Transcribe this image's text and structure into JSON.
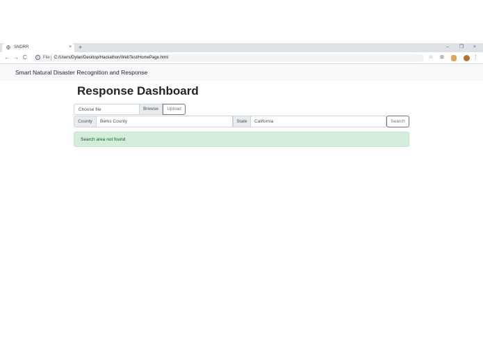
{
  "browser": {
    "tab_title": "SNDRR",
    "tab_close": "×",
    "new_tab": "+",
    "window_controls": {
      "minimize": "–",
      "restore": "❐",
      "close": "×"
    },
    "nav": {
      "back": "←",
      "forward": "→",
      "reload": "C"
    },
    "address": {
      "scheme_label": "File",
      "url": "C:/Users/Dylan/Desktop/Hackathon/WebTest/HomePage.html"
    }
  },
  "navbar": {
    "brand": "Smart Natural Disaster Recognition and Response"
  },
  "page": {
    "heading": "Response Dashboard",
    "file_upload": {
      "placeholder": "Choose file",
      "browse_label": "Browse",
      "upload_label": "Upload"
    },
    "search": {
      "county_label": "County",
      "county_value": "Berks County",
      "state_label": "State",
      "state_value": "California",
      "search_label": "Search"
    },
    "alert": {
      "message": "Search area not found"
    }
  },
  "colors": {
    "alert_bg": "#d4edda",
    "alert_text": "#155724",
    "navbar_bg": "#f8f9fa",
    "tabstrip_bg": "#dee1e6"
  }
}
